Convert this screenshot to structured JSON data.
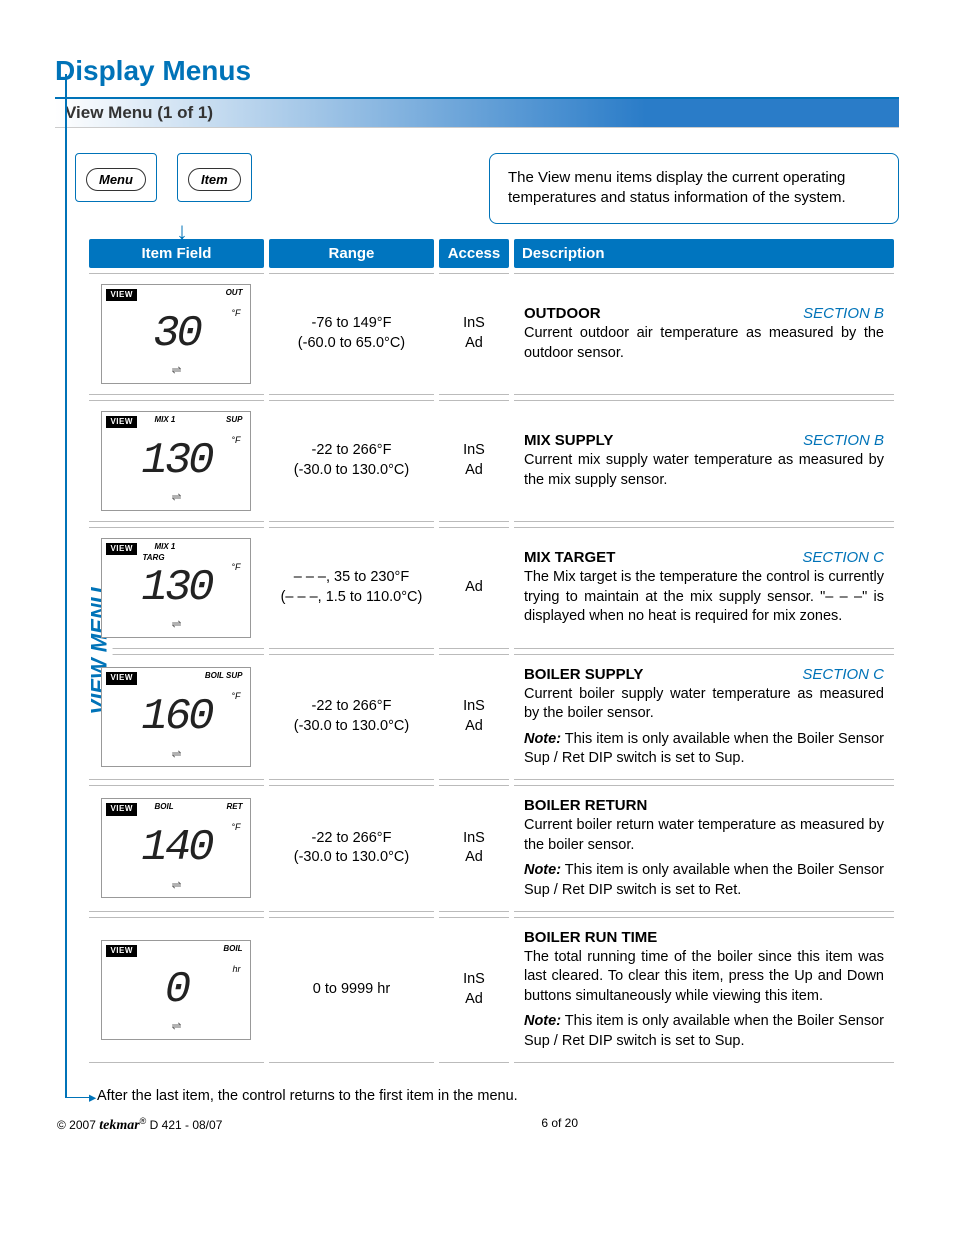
{
  "page": {
    "title": "Display Menus",
    "subtitle": "View Menu (1 of 1)",
    "menu_button": "Menu",
    "item_button": "Item",
    "info_text": "The View menu items display the current operating temperatures and status information of the system.",
    "rail_label": "VIEW MENU",
    "after_note": "After the last item, the control returns to the first item in the menu.",
    "footer_left_copy": "© 2007",
    "footer_left_brand": "tekmar",
    "footer_left_reg": "®",
    "footer_left_doc": " D 421 - 08/07",
    "footer_center": "6 of 20"
  },
  "headers": {
    "item": "Item Field",
    "range": "Range",
    "access": "Access",
    "desc": "Description"
  },
  "rows": [
    {
      "lcd": {
        "badge": "VIEW",
        "lbl1": "",
        "lbl2": "OUT",
        "targ": "",
        "seg": "30",
        "unit": "°F"
      },
      "range_line1": "-76 to 149°F",
      "range_line2": "(-60.0 to 65.0°C)",
      "access_line1": "InS",
      "access_line2": "Ad",
      "name": "OUTDOOR",
      "section": "SECTION B",
      "body": "Current outdoor air temperature as measured by the outdoor sensor.",
      "note": ""
    },
    {
      "lcd": {
        "badge": "VIEW",
        "lbl1": "MIX 1",
        "lbl2": "SUP",
        "targ": "",
        "seg": "130",
        "unit": "°F"
      },
      "range_line1": "-22 to 266°F",
      "range_line2": "(-30.0 to 130.0°C)",
      "access_line1": "InS",
      "access_line2": "Ad",
      "name": "MIX SUPPLY",
      "section": "SECTION B",
      "body": "Current mix supply water temperature as measured by the mix supply sensor.",
      "note": ""
    },
    {
      "lcd": {
        "badge": "VIEW",
        "lbl1": "MIX 1",
        "lbl2": "",
        "targ": "TARG",
        "seg": "130",
        "unit": "°F"
      },
      "range_line1": "– – –, 35 to 230°F",
      "range_line2": "(– – –, 1.5 to 110.0°C)",
      "access_line1": "",
      "access_line2": "Ad",
      "name": "MIX TARGET",
      "section": "SECTION C",
      "body": "The Mix target is the temperature the control is currently trying to maintain at the mix supply sensor. \"– – –\" is displayed when no heat is required for mix zones.",
      "note": ""
    },
    {
      "lcd": {
        "badge": "VIEW",
        "lbl1": "",
        "lbl2": "BOIL SUP",
        "targ": "",
        "seg": "160",
        "unit": "°F"
      },
      "range_line1": "-22 to 266°F",
      "range_line2": "(-30.0 to 130.0°C)",
      "access_line1": "InS",
      "access_line2": "Ad",
      "name": "BOILER SUPPLY",
      "section": "SECTION C",
      "body": "Current boiler supply water temperature as measured by the boiler sensor.",
      "note": "This item is only available when the Boiler Sensor Sup / Ret DIP switch is set to Sup."
    },
    {
      "lcd": {
        "badge": "VIEW",
        "lbl1": "BOIL",
        "lbl2": "RET",
        "targ": "",
        "seg": "140",
        "unit": "°F"
      },
      "range_line1": "-22 to 266°F",
      "range_line2": "(-30.0 to 130.0°C)",
      "access_line1": "InS",
      "access_line2": "Ad",
      "name": "BOILER RETURN",
      "section": "",
      "body": "Current boiler return water temperature as measured by the boiler sensor.",
      "note": "This item is only available when the Boiler Sensor Sup / Ret DIP switch is set to Ret."
    },
    {
      "lcd": {
        "badge": "VIEW",
        "lbl1": "",
        "lbl2": "BOIL",
        "targ": "",
        "seg": "0",
        "unit": "hr"
      },
      "range_line1": "0 to 9999 hr",
      "range_line2": "",
      "access_line1": "InS",
      "access_line2": "Ad",
      "name": "BOILER RUN TIME",
      "section": "",
      "body": "The total running time of the boiler since this item was last cleared. To clear this item, press the Up and Down buttons simultaneously while viewing this item.",
      "note": "This item is only available when the Boiler Sensor Sup / Ret DIP switch is set to Sup."
    }
  ],
  "labels": {
    "note": "Note:"
  }
}
